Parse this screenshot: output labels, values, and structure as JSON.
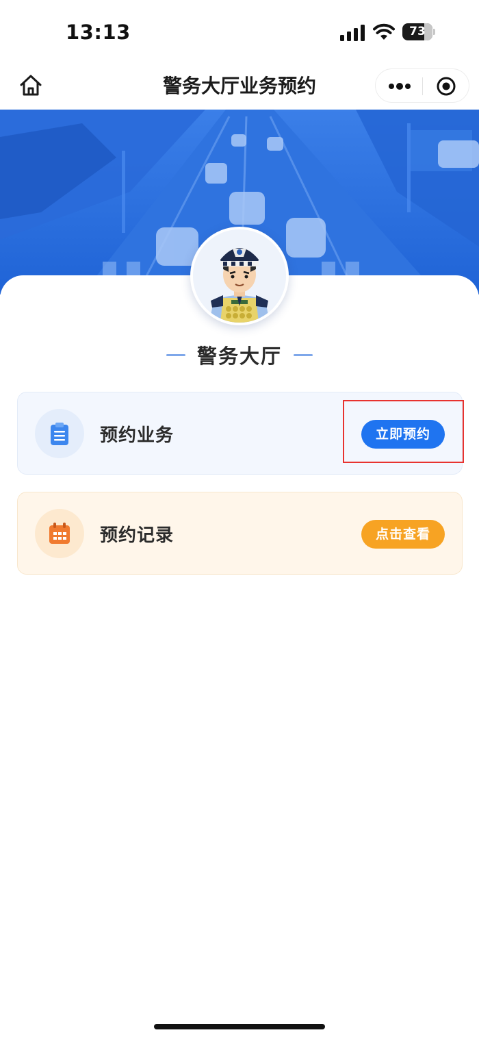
{
  "status_bar": {
    "time": "13:13",
    "battery_level": "73",
    "battery_fraction": 0.73
  },
  "nav": {
    "title": "警务大厅业务预约",
    "home_icon": "home-icon",
    "more_icon": "more-dots-icon",
    "close_icon": "target-circle-icon"
  },
  "hall": {
    "title": "警务大厅",
    "avatar": "police-officer-cartoon"
  },
  "cards": {
    "book": {
      "label": "预约业务",
      "button": "立即预约",
      "icon": "clipboard-icon",
      "button_color": "#1f74f0"
    },
    "record": {
      "label": "预约记录",
      "button": "点击查看",
      "icon": "calendar-icon",
      "button_color": "#f7a323"
    }
  },
  "colors": {
    "banner_blue": "#2b6fe0",
    "accent_blue": "#1f74f0",
    "accent_orange": "#f7a323",
    "highlight_red": "#e8332f"
  }
}
